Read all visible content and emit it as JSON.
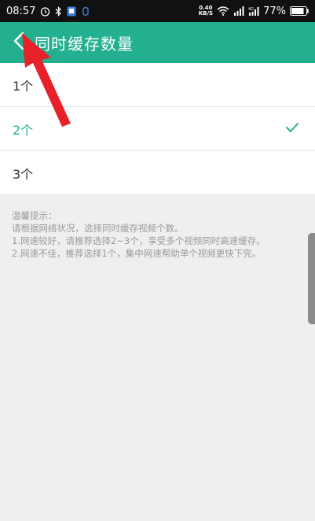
{
  "status_bar": {
    "time": "08:57",
    "net_speed_value": "0.40",
    "net_speed_unit": "KB/S",
    "battery": "77%",
    "icons": [
      "alarm-icon",
      "bluetooth-icon",
      "app-notification-icon",
      "ring-notification-icon",
      "wifi-icon",
      "signal-icon",
      "signal-4g-icon",
      "battery-icon"
    ]
  },
  "header": {
    "title": "同时缓存数量",
    "back_icon": "chevron-left-icon",
    "background": "#23b08e"
  },
  "options": [
    {
      "label": "1个",
      "selected": false
    },
    {
      "label": "2个",
      "selected": true
    },
    {
      "label": "3个",
      "selected": false
    }
  ],
  "hint": {
    "heading": "温馨提示：",
    "line1": "请根据网络状况，选择同时缓存视频个数。",
    "line2": "1.网速较好，请推荐选择2~3个，享受多个视频同时高速缓存。",
    "line3": "2.网速不佳，推荐选择1个，集中网速帮助单个视频更快下完。"
  },
  "colors": {
    "accent": "#23b08e",
    "annotation_arrow": "#e8202a"
  }
}
